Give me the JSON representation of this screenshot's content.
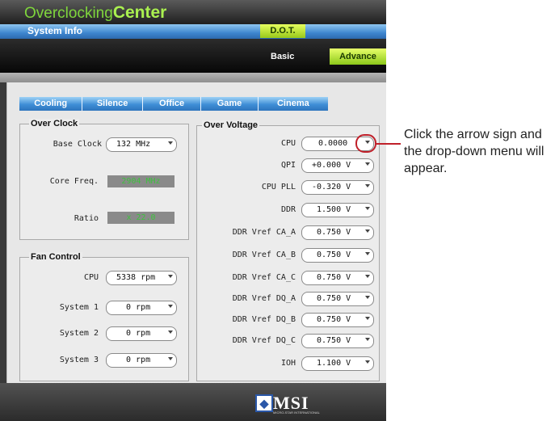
{
  "app": {
    "title_prefix": "Overclocking",
    "title_suffix": "Center",
    "tab_system_info": "System Info",
    "tab_dot": "D.O.T.",
    "sub_basic": "Basic",
    "sub_advance": "Advance"
  },
  "profiles": [
    "Cooling",
    "Silence",
    "Office",
    "Game",
    "Cinema"
  ],
  "overclock": {
    "title": "Over Clock",
    "base_clock_label": "Base Clock",
    "base_clock_value": "132 MHz",
    "core_freq_label": "Core Freq.",
    "core_freq_value": "2904 MHz",
    "ratio_label": "Ratio",
    "ratio_value": "x 22.0"
  },
  "fan": {
    "title": "Fan Control",
    "rows": [
      {
        "label": "CPU",
        "value": "5338 rpm"
      },
      {
        "label": "System 1",
        "value": "0 rpm"
      },
      {
        "label": "System 2",
        "value": "0 rpm"
      },
      {
        "label": "System 3",
        "value": "0 rpm"
      }
    ]
  },
  "voltage": {
    "title": "Over Voltage",
    "rows": [
      {
        "label": "CPU",
        "value": "0.0000"
      },
      {
        "label": "QPI",
        "value": "+0.000 V"
      },
      {
        "label": "CPU PLL",
        "value": "-0.320 V"
      },
      {
        "label": "DDR",
        "value": "1.500 V"
      },
      {
        "label": "DDR Vref CA_A",
        "value": "0.750 V"
      },
      {
        "label": "DDR Vref CA_B",
        "value": "0.750 V"
      },
      {
        "label": "DDR Vref CA_C",
        "value": "0.750 V"
      },
      {
        "label": "DDR Vref DQ_A",
        "value": "0.750 V"
      },
      {
        "label": "DDR Vref DQ_B",
        "value": "0.750 V"
      },
      {
        "label": "DDR Vref DQ_C",
        "value": "0.750 V"
      },
      {
        "label": "IOH",
        "value": "1.100 V"
      }
    ]
  },
  "footer": {
    "brand": "MSI",
    "brand_sub": "MICRO-STAR INTERNATIONAL"
  },
  "callout": {
    "text": "Click the arrow sign and the drop-down menu will appear."
  },
  "colors": {
    "accent_blue": "#3f8ed6",
    "accent_green": "#aaf050",
    "callout_red": "#c0202a"
  }
}
